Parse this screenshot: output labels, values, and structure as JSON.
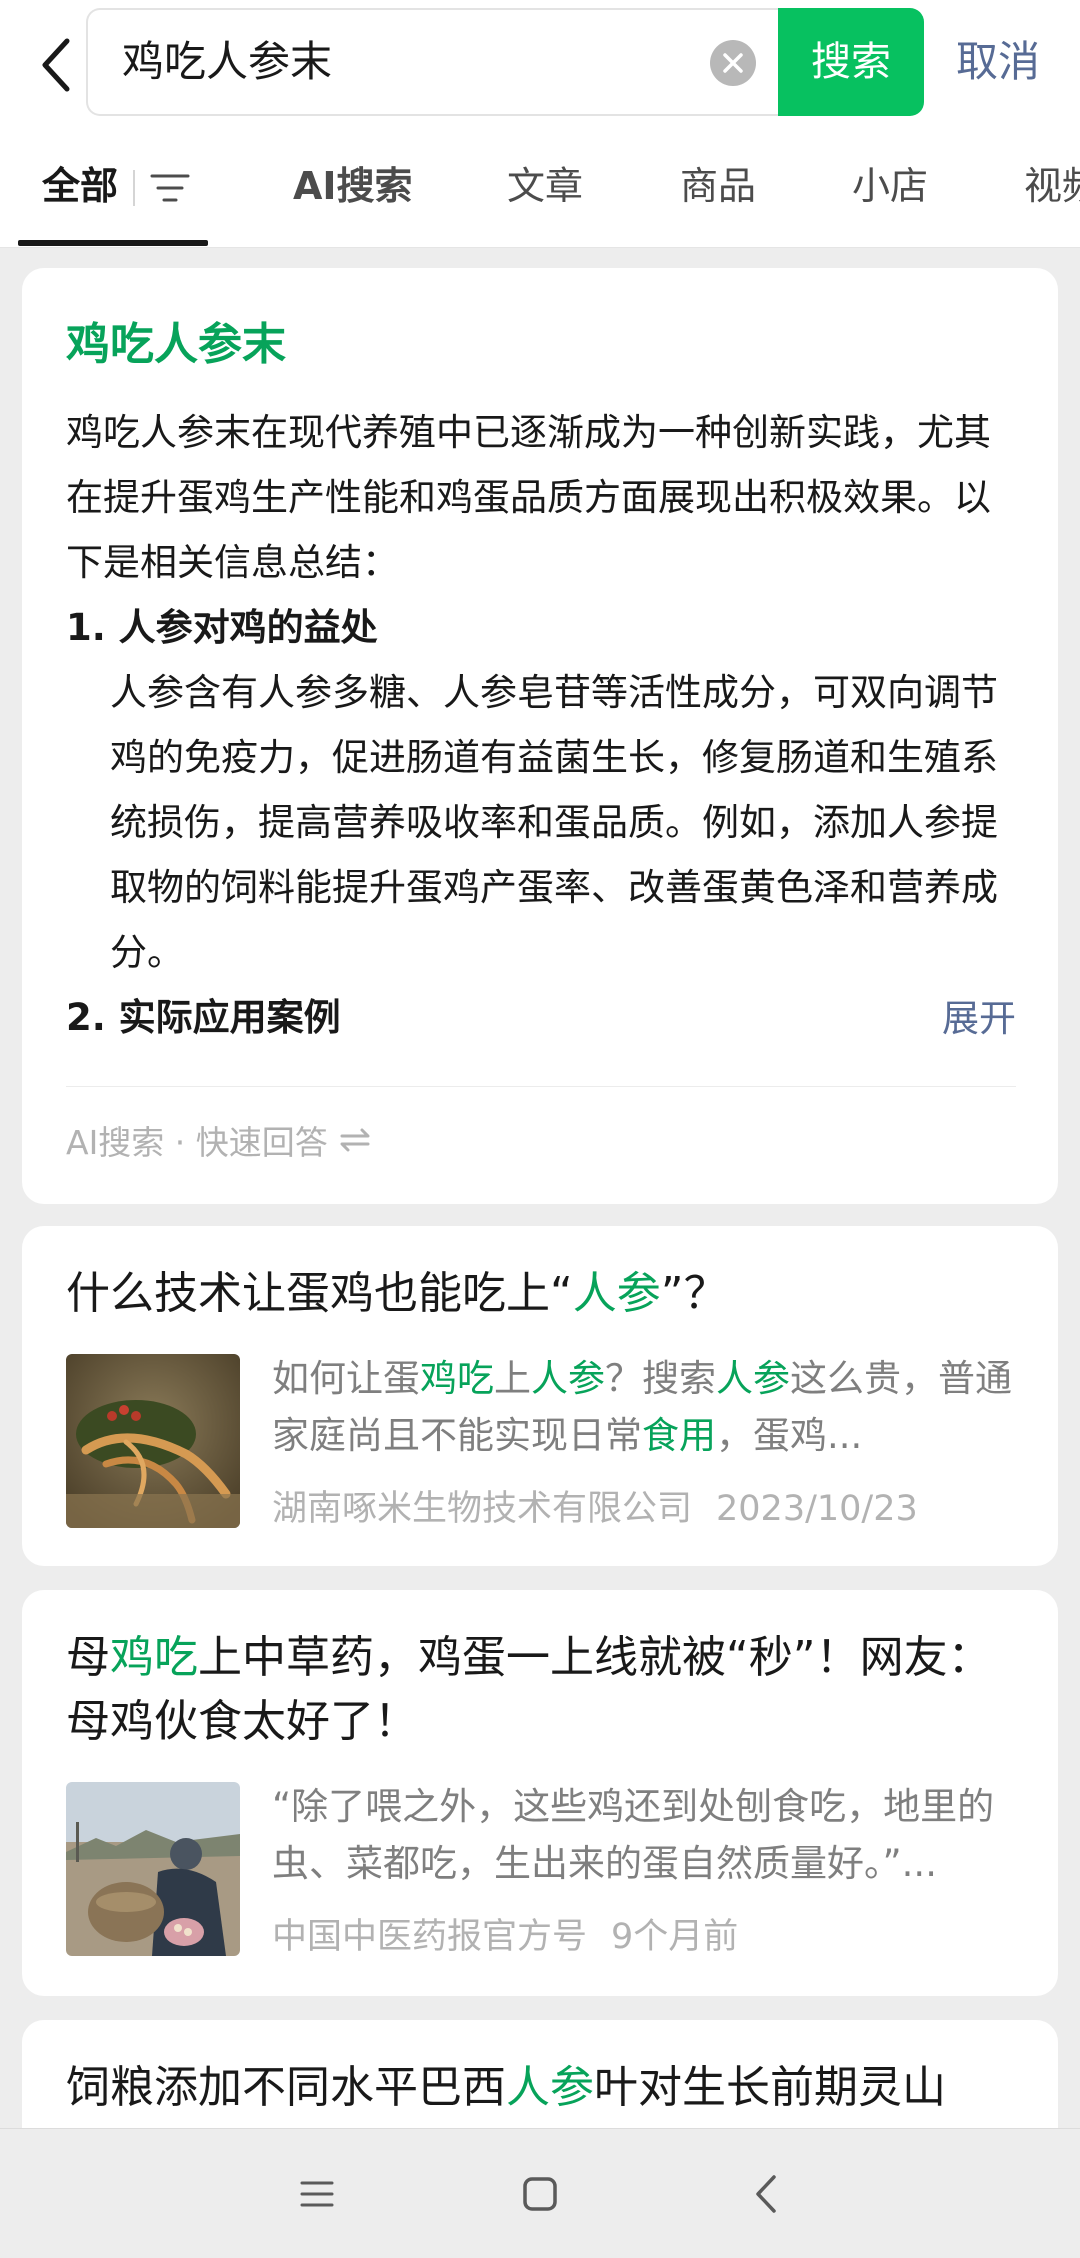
{
  "header": {
    "back_icon": "chevron-left-icon",
    "query": "鸡吃人参末",
    "clear_icon": "clear-x-icon",
    "search_label": "搜索",
    "cancel_label": "取消"
  },
  "tabs": [
    {
      "label": "全部",
      "active": true
    },
    {
      "label": "AI搜索"
    },
    {
      "label": "文章"
    },
    {
      "label": "商品"
    },
    {
      "label": "小店"
    },
    {
      "label": "视频"
    }
  ],
  "ai_card": {
    "title": "鸡吃人参末",
    "intro": "鸡吃人参末在现代养殖中已逐渐成为一种创新实践，尤其在提升蛋鸡生产性能和鸡蛋品质方面展现出积极效果。以下是相关信息总结：",
    "section1_title": "1. 人参对鸡的益处",
    "section1_text": "人参含有人参多糖、人参皂苷等活性成分，可双向调节鸡的免疫力，促进肠道有益菌生长，修复肠道和生殖系统损伤，提高营养吸收率和蛋品质。例如，添加人参提取物的饲料能提升蛋鸡产蛋率、改善蛋黄色泽和营养成分。",
    "section2_title": "2. 实际应用案例",
    "expand_label": "展开",
    "footer_label": "AI搜索 · 快速回答",
    "footer_icon": "swap-arrows-icon"
  },
  "results": [
    {
      "title_parts": [
        "什么技术让蛋鸡也能吃上“",
        "人参",
        "”？"
      ],
      "snippet_parts": [
        "如何让蛋",
        "鸡吃",
        "上",
        "人参",
        "？搜索",
        "人参",
        "这么贵，普通家庭尚且不能实现日常",
        "食用",
        "，蛋鸡..."
      ],
      "source": "湖南啄米生物技术有限公司",
      "date": "2023/10/23",
      "thumb": "ginseng-photo"
    },
    {
      "title_parts": [
        "母",
        "鸡吃",
        "上中草药，鸡蛋一上线就被“秒”！网友：母鸡伙食太好了！"
      ],
      "snippet_text": "“除了喂之外，这些鸡还到处刨食吃，地里的虫、菜都吃，生出来的蛋自然质量好。”...",
      "source": "中国中医药报官方号",
      "date": "9个月前",
      "thumb": "farmer-photo"
    },
    {
      "title_parts": [
        "饲粮添加不同水平巴西",
        "人参",
        "叶对生长前期灵山"
      ]
    }
  ],
  "colors": {
    "accent": "#07c160",
    "highlight": "#07a35a",
    "link": "#576b95"
  },
  "navbar": {
    "menu_icon": "menu-icon",
    "home_icon": "square-home-icon",
    "back_icon": "nav-back-icon"
  }
}
